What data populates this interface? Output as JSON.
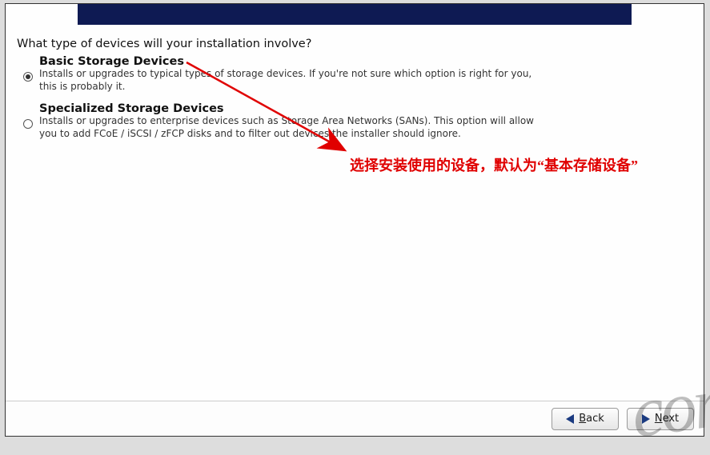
{
  "question": "What type of devices will your installation involve?",
  "options": {
    "basic": {
      "title": "Basic Storage Devices",
      "desc": "Installs or upgrades to typical types of storage devices.  If you're not sure which option is right for you,\nthis is probably it.",
      "selected": true
    },
    "specialized": {
      "title": "Specialized Storage Devices",
      "desc": "Installs or upgrades to enterprise devices such as Storage Area Networks (SANs). This option will allow\nyou to add FCoE / iSCSI / zFCP disks and to filter out devices the installer should ignore.",
      "selected": false
    }
  },
  "annotation": "选择安装使用的设备，默认为“基本存储设备”",
  "buttons": {
    "back_prefix": "B",
    "back_rest": "ack",
    "next_prefix": "N",
    "next_rest": "ext"
  },
  "watermark": "con"
}
